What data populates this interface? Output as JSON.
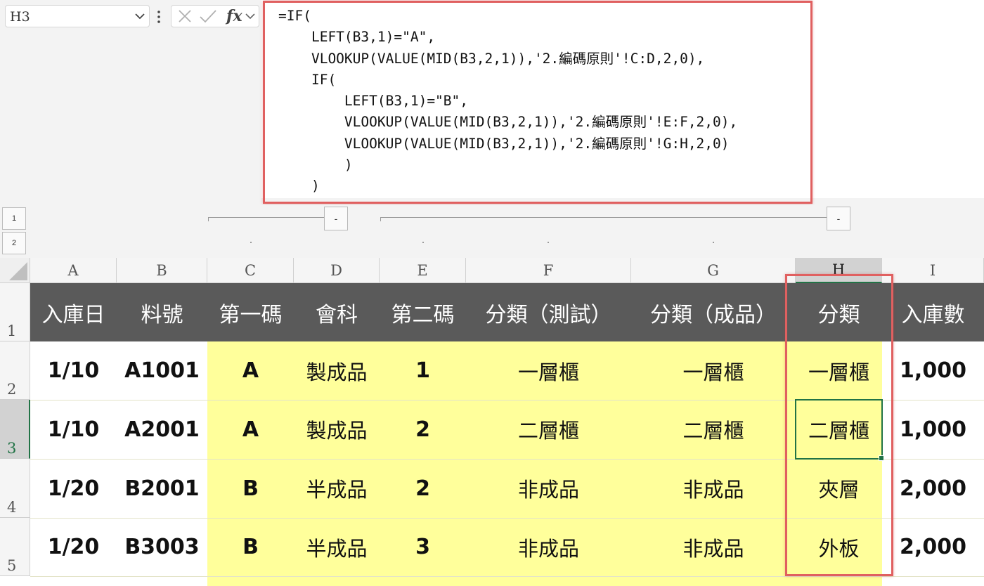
{
  "name_box": {
    "value": "H3"
  },
  "formula": {
    "lines": [
      "=IF(",
      "    LEFT(B3,1)=\"A\",",
      "    VLOOKUP(VALUE(MID(B3,2,1)),'2.編碼原則'!C:D,2,0),",
      "    IF(",
      "        LEFT(B3,1)=\"B\",",
      "        VLOOKUP(VALUE(MID(B3,2,1)),'2.編碼原則'!E:F,2,0),",
      "        VLOOKUP(VALUE(MID(B3,2,1)),'2.編碼原則'!G:H,2,0)",
      "        )",
      "    )"
    ]
  },
  "formula_buttons": {
    "fx_label": "fx"
  },
  "outline": {
    "levels": [
      "1",
      "2"
    ],
    "collapse_label": "-"
  },
  "columns": [
    "A",
    "B",
    "C",
    "D",
    "E",
    "F",
    "G",
    "H",
    "I"
  ],
  "rows": [
    "1",
    "2",
    "3",
    "4",
    "5"
  ],
  "table": {
    "headers": [
      "入庫日",
      "料號",
      "第一碼",
      "會科",
      "第二碼",
      "分類（測試）",
      "分類（成品）",
      "分類",
      "入庫數"
    ],
    "data": [
      [
        "1/10",
        "A1001",
        "A",
        "製成品",
        "1",
        "一層櫃",
        "一層櫃",
        "一層櫃",
        "1,000"
      ],
      [
        "1/10",
        "A2001",
        "A",
        "製成品",
        "2",
        "二層櫃",
        "二層櫃",
        "二層櫃",
        "1,000"
      ],
      [
        "1/20",
        "B2001",
        "B",
        "半成品",
        "2",
        "非成品",
        "非成品",
        "夾層",
        "2,000"
      ],
      [
        "1/20",
        "B3003",
        "B",
        "半成品",
        "3",
        "非成品",
        "非成品",
        "外板",
        "2,000"
      ]
    ]
  },
  "selection": {
    "active_cell": "H3",
    "selected_column": "H",
    "selected_row": "3"
  },
  "colors": {
    "header_fill": "#5a5a5a",
    "highlight_fill": "#ffff9b",
    "annotation": "#e06060",
    "selection": "#217346"
  },
  "icons": {
    "name_box_dropdown": "chevron-down-icon",
    "more": "more-vertical-icon",
    "cancel": "close-icon",
    "enter": "check-icon",
    "insert_function": "function-icon"
  }
}
